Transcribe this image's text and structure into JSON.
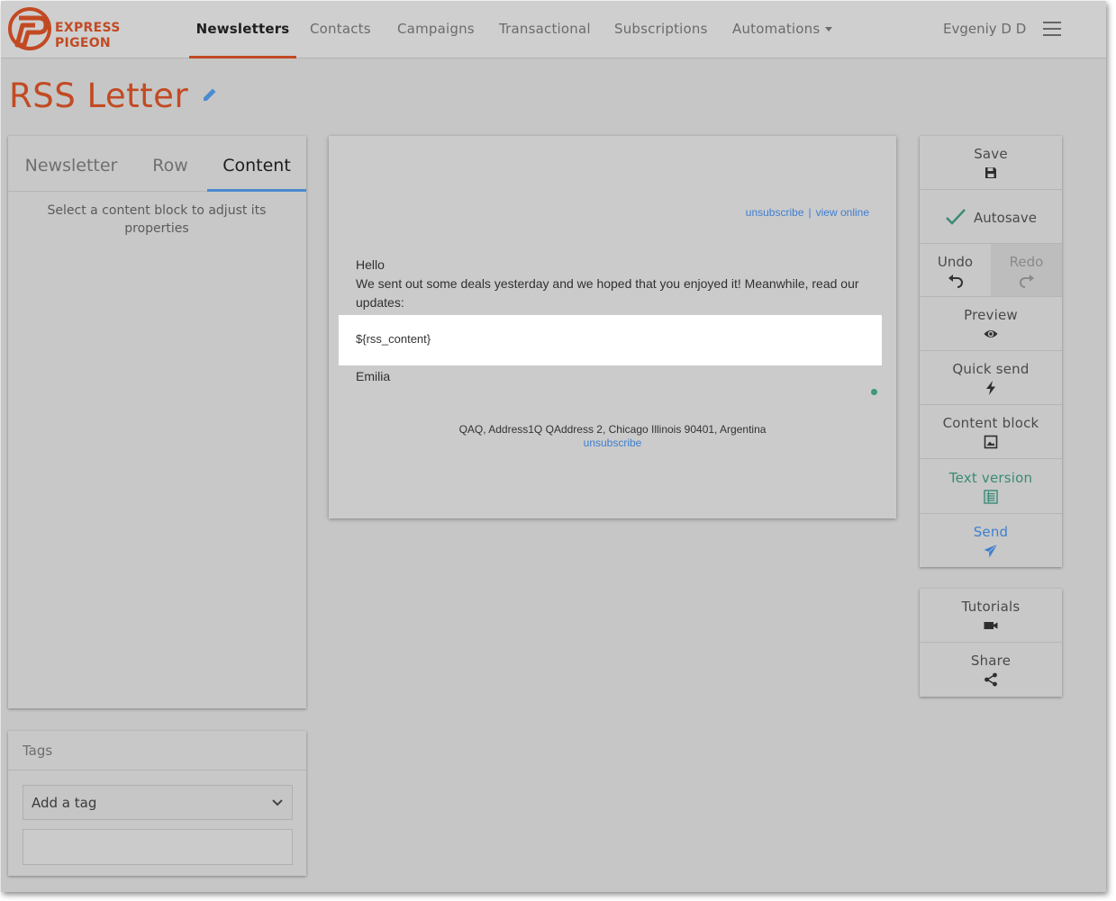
{
  "brand": {
    "line1": "EXPRESS",
    "line2": "PIGEON",
    "color": "#c24a23"
  },
  "nav": {
    "items": [
      {
        "label": "Newsletters",
        "active": true
      },
      {
        "label": "Contacts"
      },
      {
        "label": "Campaigns"
      },
      {
        "label": "Transactional"
      },
      {
        "label": "Subscriptions"
      },
      {
        "label": "Automations"
      }
    ],
    "user": "Evgeniy D D"
  },
  "page": {
    "title": "RSS Letter"
  },
  "left_panel": {
    "tabs": [
      "Newsletter",
      "Row",
      "Content"
    ],
    "active_tab": "Content",
    "hint": "Select a content block to adjust its properties"
  },
  "tags": {
    "title": "Tags",
    "placeholder": "Add a tag",
    "input_value": ""
  },
  "email": {
    "unsubscribe_link": "unsubscribe",
    "separator": "|",
    "view_online_link": "view online",
    "greeting": "Hello",
    "body": "We sent out some deals yesterday and we hoped that you enjoyed it! Meanwhile, read our updates:",
    "rss_placeholder": "${rss_content}",
    "signature": "Emilia",
    "footer_address": "QAQ, Address1Q QAddress 2, Chicago Illinois 90401, Argentina",
    "footer_unsubscribe": "unsubscribe"
  },
  "actions": {
    "save": "Save",
    "autosave": "Autosave",
    "undo": "Undo",
    "redo": "Redo",
    "preview": "Preview",
    "quick_send": "Quick send",
    "content_block": "Content block",
    "text_version": "Text version",
    "send": "Send",
    "tutorials": "Tutorials",
    "share": "Share"
  },
  "colors": {
    "accent": "#c24a23",
    "tab_underline": "#4a8ad0",
    "link": "#3f7fd0",
    "green": "#3a8a74"
  }
}
